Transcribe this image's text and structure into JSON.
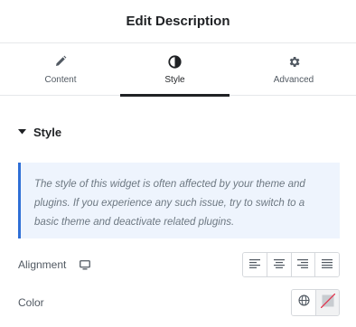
{
  "header": {
    "title": "Edit Description"
  },
  "tabs": [
    {
      "label": "Content",
      "icon": "pencil-icon",
      "active": false
    },
    {
      "label": "Style",
      "icon": "contrast-icon",
      "active": true
    },
    {
      "label": "Advanced",
      "icon": "gear-icon",
      "active": false
    }
  ],
  "section": {
    "title": "Style",
    "expanded": true
  },
  "notice": {
    "text": "The style of this widget is often affected by your theme and plugins. If you experience any such issue, try to switch to a basic theme and deactivate related plugins."
  },
  "controls": {
    "alignment": {
      "label": "Alignment",
      "device_icon": "desktop-icon",
      "options": [
        "align-left-icon",
        "align-center-icon",
        "align-right-icon",
        "align-justify-icon"
      ]
    },
    "color": {
      "label": "Color",
      "global_icon": "globe-icon",
      "swatch_state": "empty"
    }
  },
  "colors": {
    "accent_blue": "#2f6fd6",
    "notice_bg": "#eef4fd",
    "clear_red": "#e2334c"
  }
}
